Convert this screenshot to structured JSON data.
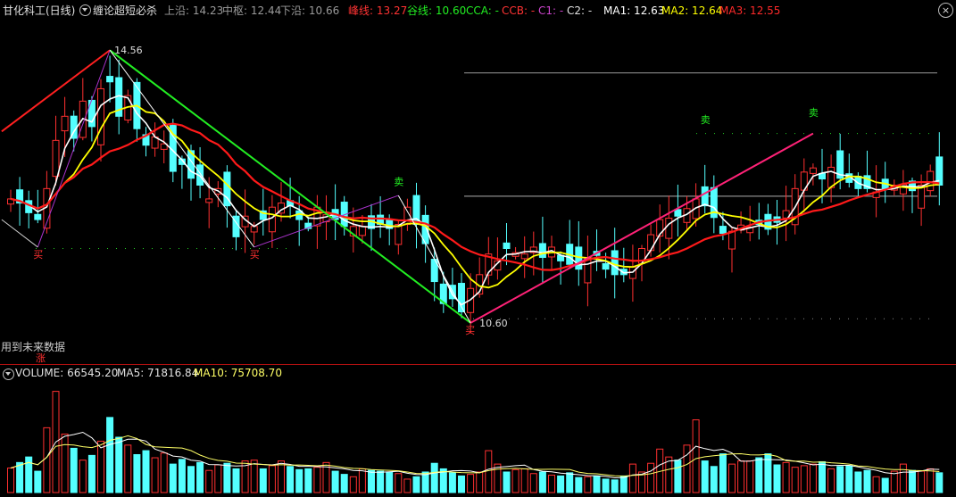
{
  "header": {
    "stock_title": "甘化科工(日线)",
    "indicator_name": "缠论超短必杀",
    "upper_label": "上沿: 14.23",
    "center_label": "中枢: 12.44",
    "lower_label": "下沿: 10.66",
    "peak_label": "峰线: 13.27",
    "valley_label": "谷线: 10.60",
    "cca_label": "CCA: -",
    "ccb_label": "CCB: -",
    "c1_label": "C1: -",
    "c2_label": "C2: -",
    "ma1_label": "MA1: 12.63",
    "ma2_label": "MA2: 12.64",
    "ma3_label": "MA3: 12.55"
  },
  "volume_header": {
    "volume_label": "VOLUME: 66545.20",
    "ma5_label": "MA5: 71816.84",
    "ma10_label": "MA10: 75708.70"
  },
  "note": "用到未来数据",
  "zhang_label": "涨",
  "annotations": {
    "high": "14.56",
    "low": "10.60",
    "sell": "卖",
    "buy": "买"
  },
  "colors": {
    "up": "#ff3030",
    "down": "#54ffff",
    "ma1": "#ffffff",
    "ma2": "#ffff00",
    "ma3": "#ff1a1a",
    "red_line": "#ff2020",
    "green_line": "#22ee22",
    "pink_line": "#ff2277",
    "magenta": "#cc33cc",
    "grid": "#8a8a8a"
  },
  "chart_data": {
    "type": "candlestick",
    "price_range": [
      10.3,
      14.9
    ],
    "guides": {
      "upper": 14.23,
      "center": 12.44,
      "lower": 10.66
    },
    "high_point": 14.56,
    "low_point": 10.6,
    "close": [
      12.4,
      12.34,
      12.2,
      12.1,
      12.55,
      13.25,
      13.6,
      13.28,
      13.82,
      13.45,
      14.0,
      14.1,
      13.6,
      13.9,
      13.42,
      13.18,
      13.3,
      13.2,
      12.8,
      12.9,
      12.7,
      12.6,
      12.4,
      12.55,
      12.3,
      11.85,
      12.15,
      12.0,
      12.1,
      12.28,
      12.34,
      12.3,
      12.1,
      11.97,
      12.28,
      12.17,
      12.1,
      12.0,
      12.0,
      12.0,
      11.97,
      12.03,
      11.97,
      12.03,
      12.28,
      12.03,
      11.75,
      11.2,
      10.88,
      10.95,
      10.76,
      11.1,
      11.3,
      11.6,
      11.5,
      11.68,
      11.62,
      11.6,
      11.7,
      11.55,
      11.7,
      11.5,
      11.45,
      11.38,
      11.53,
      11.58,
      11.38,
      11.3,
      11.3,
      11.41,
      11.68,
      11.88,
      12.1,
      12.12,
      12.15,
      12.26,
      12.4,
      12.3,
      12.13,
      11.9,
      11.93,
      12.02,
      11.99,
      12.03,
      11.96,
      12.06,
      12.23,
      12.55,
      12.79,
      12.85,
      12.69,
      12.86,
      12.7,
      12.64,
      12.55,
      12.55,
      12.5,
      12.55,
      12.6,
      12.61,
      12.52,
      12.6,
      12.8,
      12.6
    ],
    "volume": [
      31000,
      38000,
      45000,
      27000,
      82000,
      128000,
      74000,
      56000,
      41000,
      47000,
      65000,
      95000,
      70000,
      60000,
      48000,
      53000,
      44000,
      50000,
      36000,
      42000,
      33000,
      38000,
      28000,
      35000,
      37000,
      30000,
      40000,
      41000,
      30000,
      34000,
      40000,
      33000,
      29000,
      30000,
      32000,
      38000,
      27000,
      23000,
      20000,
      30000,
      28000,
      27000,
      26000,
      24000,
      17000,
      20000,
      26000,
      37000,
      30000,
      25000,
      21000,
      23000,
      26000,
      53000,
      36000,
      26000,
      29000,
      30000,
      24000,
      26000,
      22000,
      21000,
      25000,
      19000,
      20000,
      21000,
      17000,
      16000,
      21000,
      36000,
      26000,
      37000,
      55000,
      45000,
      41000,
      60000,
      92000,
      40000,
      33000,
      49000,
      36000,
      40000,
      40000,
      44000,
      49000,
      35000,
      38000,
      32000,
      34000,
      36000,
      39000,
      30000,
      33000,
      34000,
      26000,
      28000,
      20000,
      18000,
      27000,
      36000,
      28000,
      27000,
      30000,
      25000
    ],
    "summary": {
      "MA1": 12.63,
      "MA2": 12.64,
      "MA3": 12.55,
      "VOLUME": 66545.2,
      "MA5": 71816.84,
      "MA10": 75708.7
    }
  }
}
